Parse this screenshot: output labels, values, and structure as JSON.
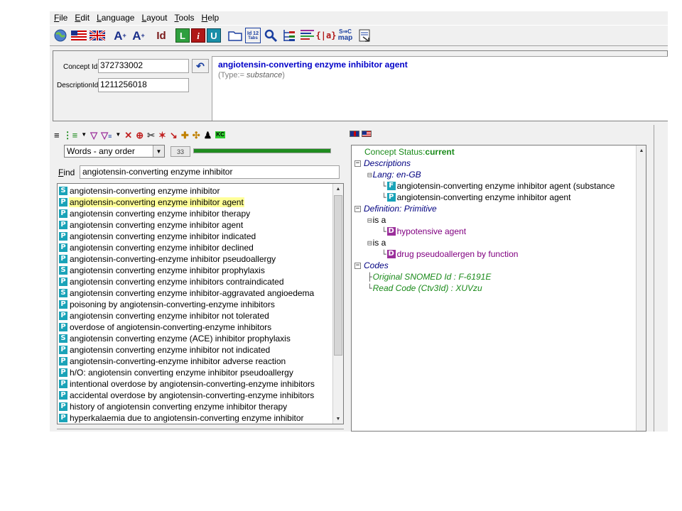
{
  "menubar": [
    {
      "label": "File",
      "u": "F",
      "rest": "ile"
    },
    {
      "label": "Edit",
      "u": "E",
      "rest": "dit"
    },
    {
      "label": "Language",
      "u": "L",
      "rest": "anguage"
    },
    {
      "label": "Layout",
      "u": "L",
      "rest": "ayout"
    },
    {
      "label": "Tools",
      "u": "T",
      "rest": "ools"
    },
    {
      "label": "Help",
      "u": "H",
      "rest": "elp"
    }
  ],
  "toolbar": {
    "font_bigger": "A",
    "font_smaller": "A",
    "id_label": "Id",
    "l_label": "L",
    "i_label": "i",
    "u_label": "U",
    "id12_label": "Id 12",
    "snomap_label": "S→C map"
  },
  "concept": {
    "concept_id_label": "Concept Id",
    "concept_id": "372733002",
    "description_id_label": "DescriptionId",
    "description_id": "1211256018",
    "title": "angiotensin-converting enzyme inhibitor agent",
    "type_prefix": "(Type:= ",
    "type_value": "substance",
    "type_suffix": ")"
  },
  "search": {
    "mode": "Words - any order",
    "count": "33",
    "progress": 1.0,
    "find_label_u": "F",
    "find_label_rest": "ind",
    "query": "angiotensin-converting enzyme inhibitor"
  },
  "results": [
    {
      "type": "S",
      "text": "angiotensin-converting enzyme inhibitor"
    },
    {
      "type": "P",
      "text": "angiotensin-converting enzyme inhibitor agent",
      "selected": true
    },
    {
      "type": "P",
      "text": "angiotensin converting enzyme inhibitor therapy"
    },
    {
      "type": "P",
      "text": "angiotensin converting enzyme inhibitor agent"
    },
    {
      "type": "P",
      "text": "angiotensin converting enzyme inhibitor indicated"
    },
    {
      "type": "P",
      "text": "angiotensin converting enzyme inhibitor declined"
    },
    {
      "type": "P",
      "text": "angiotensin-converting-enzyme inhibitor pseudoallergy"
    },
    {
      "type": "S",
      "text": "angiotensin converting enzyme inhibitor prophylaxis"
    },
    {
      "type": "P",
      "text": "angiotensin converting enzyme inhibitors contraindicated"
    },
    {
      "type": "S",
      "text": "angiotensin converting enzyme inhibitor-aggravated angioedema"
    },
    {
      "type": "P",
      "text": "poisoning by angiotensin-converting-enzyme inhibitors"
    },
    {
      "type": "P",
      "text": "angiotensin converting enzyme inhibitor not tolerated"
    },
    {
      "type": "P",
      "text": "overdose of angiotensin-converting-enzyme inhibitors"
    },
    {
      "type": "S",
      "text": "angiotensin converting enzyme (ACE) inhibitor prophylaxis"
    },
    {
      "type": "P",
      "text": "angiotensin converting enzyme inhibitor not indicated"
    },
    {
      "type": "P",
      "text": "angiotensin-converting-enzyme inhibitor adverse reaction"
    },
    {
      "type": "P",
      "text": "h/O: angiotensin converting enzyme inhibitor pseudoallergy"
    },
    {
      "type": "P",
      "text": "intentional overdose by angiotensin-converting-enzyme inhibitors"
    },
    {
      "type": "P",
      "text": "accidental overdose by angiotensin-converting-enzyme inhibitors"
    },
    {
      "type": "P",
      "text": "history of angiotensin converting enzyme inhibitor therapy"
    },
    {
      "type": "P",
      "text": "hyperkalaemia due to angiotensin-converting enzyme inhibitor"
    }
  ],
  "tree": {
    "status_label": "Concept Status: ",
    "status_value": "current",
    "descriptions": "Descriptions",
    "lang": "Lang: en-GB",
    "fsn_badge": "F",
    "fsn": "angiotensin-converting enzyme inhibitor agent (substance",
    "pref_badge": "P",
    "pref": "angiotensin-converting enzyme inhibitor agent",
    "definition": "Definition: Primitive",
    "is_a_1": "is a",
    "parent_1_badge": "D",
    "parent_1": "hypotensive agent",
    "is_a_2": "is a",
    "parent_2_badge": "D",
    "parent_2": "drug pseudoallergen by function",
    "codes": "Codes",
    "snomed_id": "Original SNOMED Id : F-6191E",
    "read_code": "Read Code (Ctv3Id) : XUVzu"
  },
  "colors": {
    "badge_p": "#1aa3b8",
    "badge_d": "#9b2f9b",
    "title_blue": "#0000c8",
    "tree_green": "#1a8a1a",
    "tree_navy": "#000080",
    "progress_green": "#1f8c1f",
    "highlight": "#ffff99"
  }
}
